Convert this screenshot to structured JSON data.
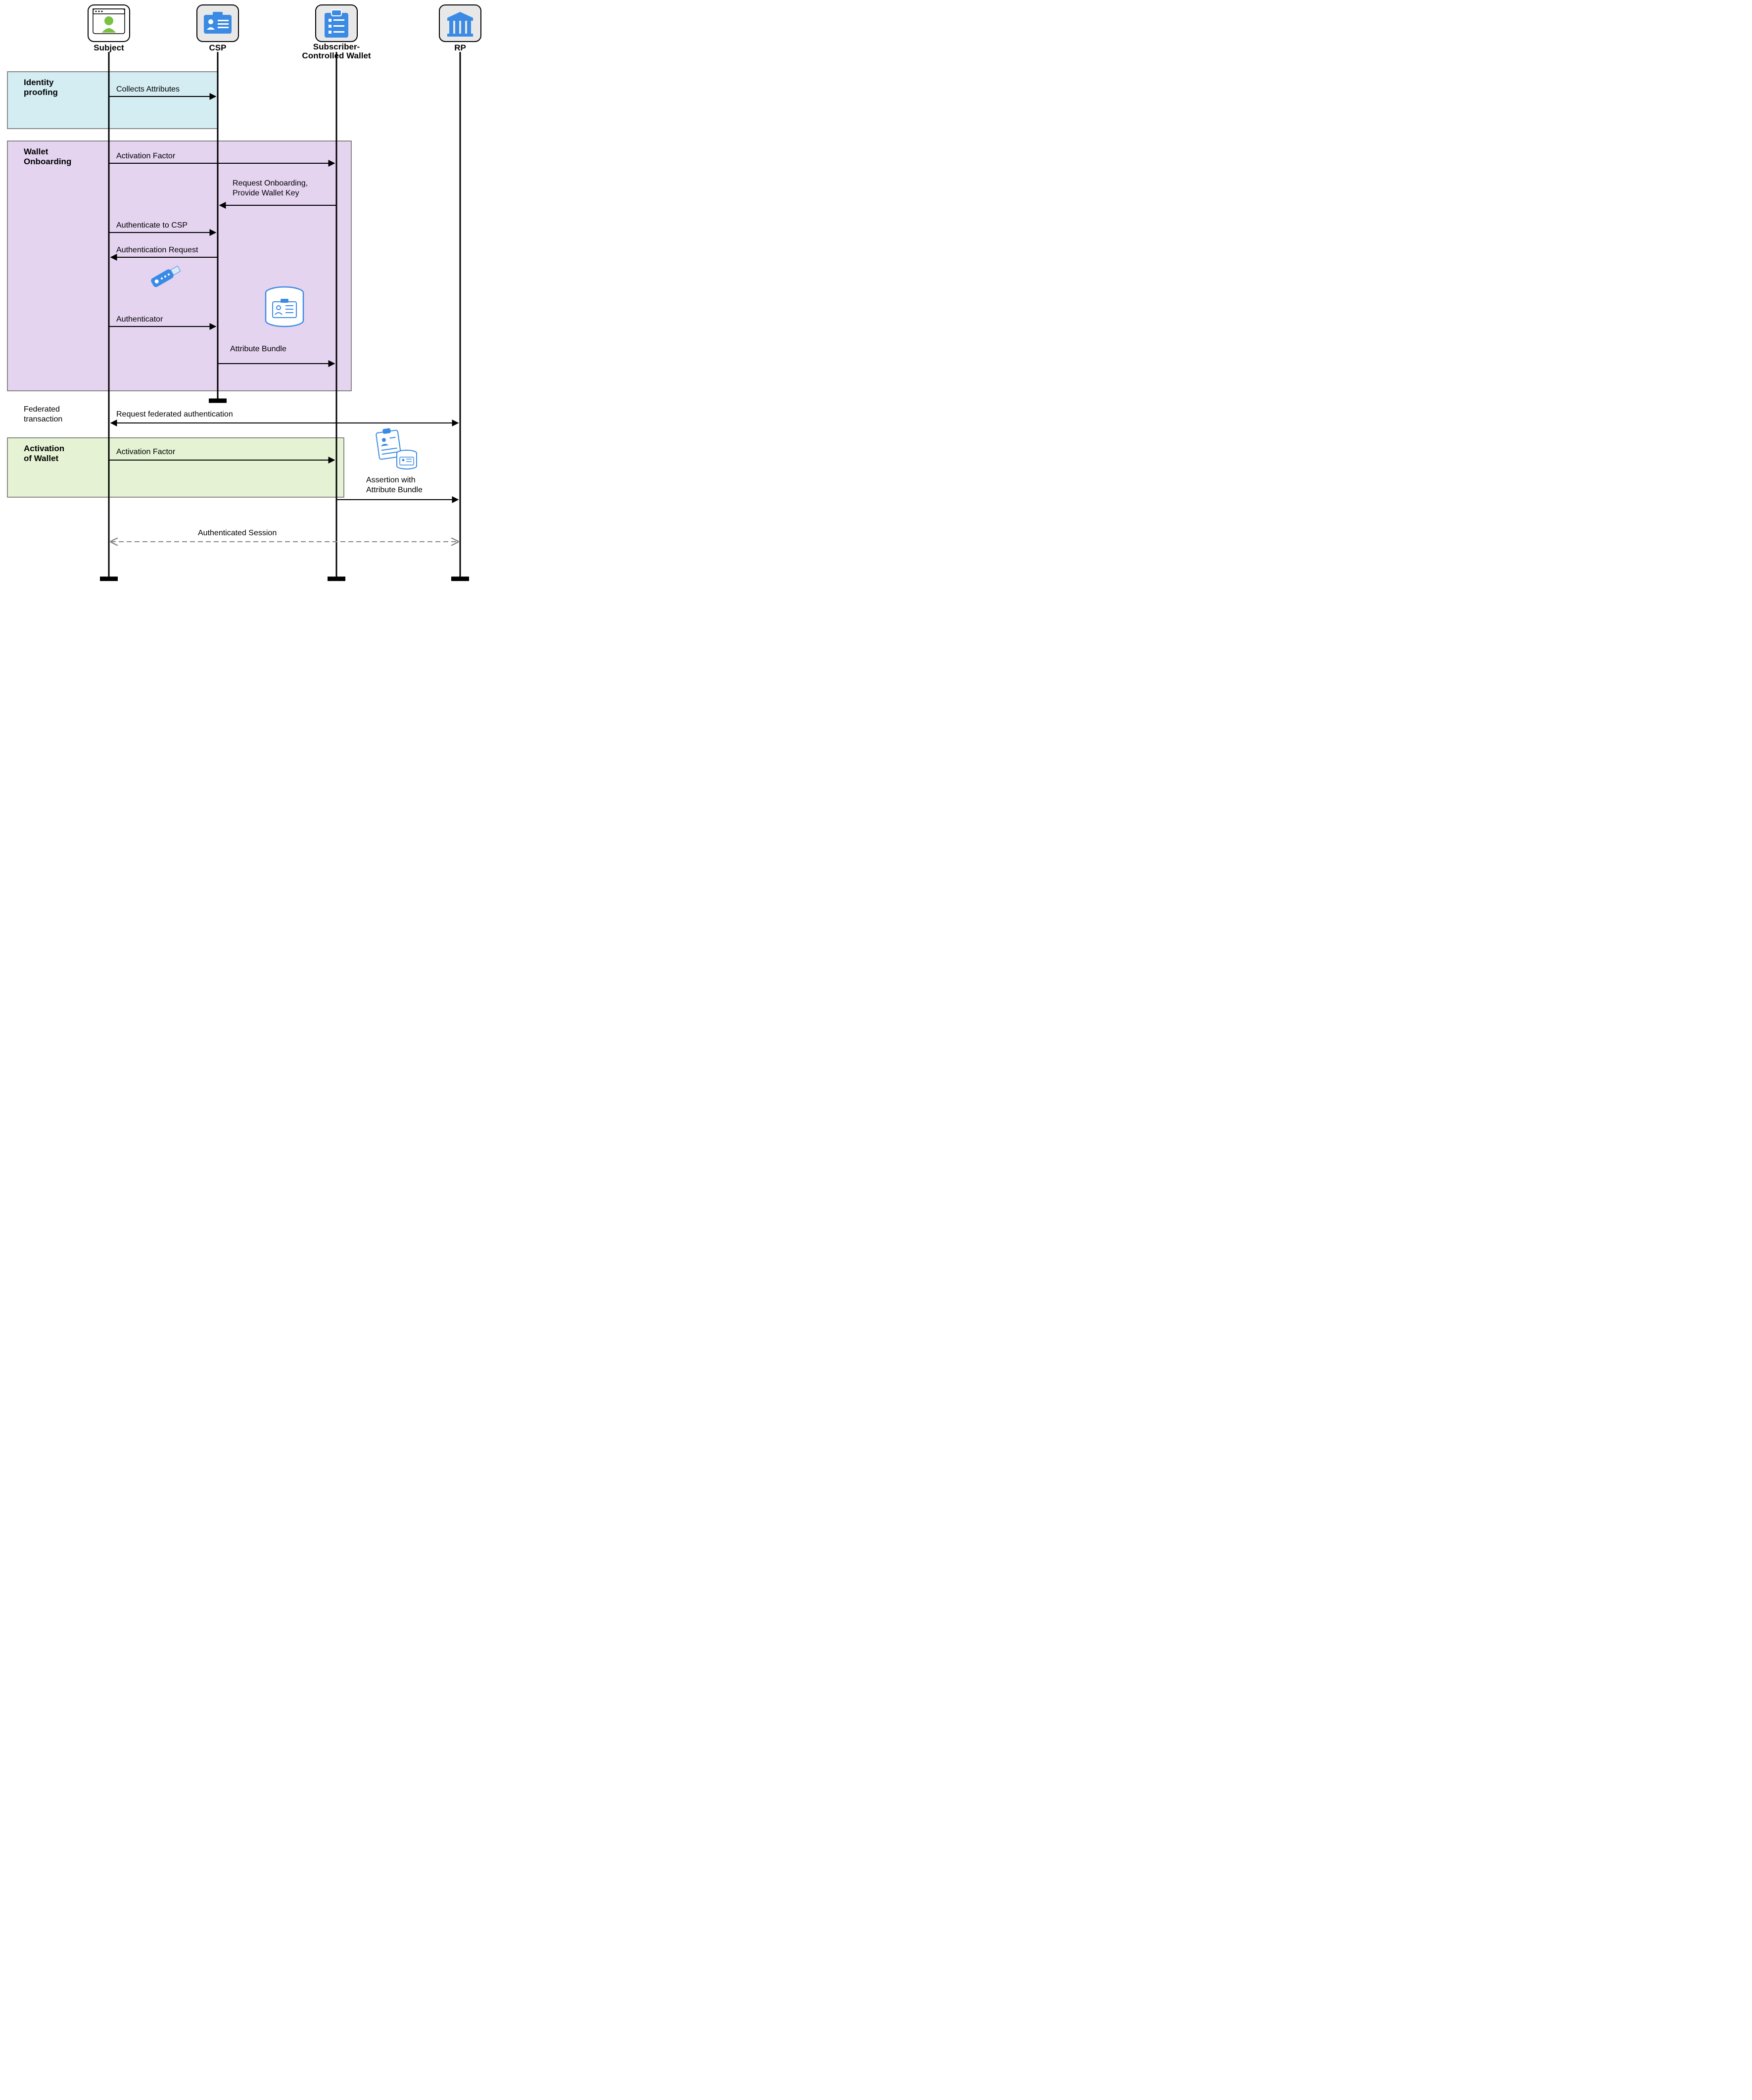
{
  "actors": {
    "subject": "Subject",
    "csp": "CSP",
    "wallet_line1": "Subscriber-",
    "wallet_line2": "Controlled Wallet",
    "rp": "RP"
  },
  "phases": {
    "identity_proofing_line1": "Identity",
    "identity_proofing_line2": "proofing",
    "wallet_onboarding_line1": "Wallet",
    "wallet_onboarding_line2": "Onboarding",
    "federated_line1": "Federated",
    "federated_line2": "transaction",
    "activation_line1": "Activation",
    "activation_line2": "of Wallet"
  },
  "messages": {
    "collects_attributes": "Collects Attributes",
    "activation_factor": "Activation Factor",
    "request_onboarding_line1": "Request Onboarding,",
    "request_onboarding_line2": "Provide Wallet Key",
    "authenticate_to_csp": "Authenticate to CSP",
    "authentication_request": "Authentication Request",
    "authenticator": "Authenticator",
    "attribute_bundle": "Attribute Bundle",
    "request_federated_auth": "Request federated authentication",
    "activation_factor2": "Activation Factor",
    "assertion_line1": "Assertion with",
    "assertion_line2": "Attribute Bundle",
    "authenticated_session": "Authenticated Session"
  },
  "colors": {
    "blue": "#3b8be5",
    "green": "#7ac142",
    "cyan_fill": "#d4edf3",
    "purple_fill": "#e5d4f0",
    "green_fill": "#e5f3d4",
    "grey_fill": "#e8e8e8",
    "border": "#666"
  }
}
